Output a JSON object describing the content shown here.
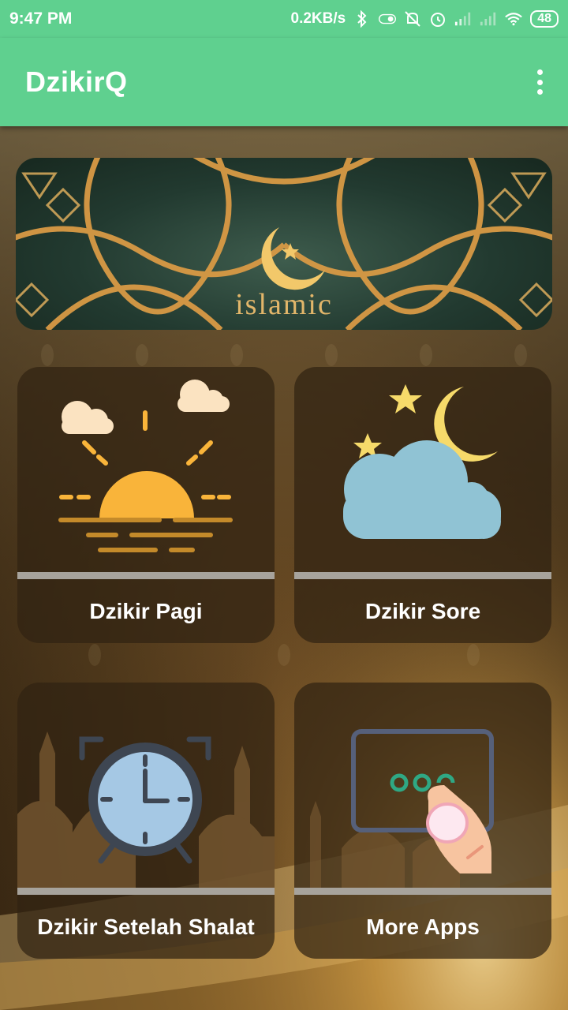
{
  "status_bar": {
    "time": "9:47 PM",
    "network_speed": "0.2KB/s",
    "battery": "48",
    "icons": [
      "bluetooth-icon",
      "toggle-icon",
      "mute-icon",
      "alarm-icon",
      "signal-icon",
      "signal-icon",
      "wifi-icon",
      "battery-icon"
    ]
  },
  "app_bar": {
    "title": "DzikirQ",
    "menu_icon": "more-vert-icon"
  },
  "banner": {
    "text": "islamic"
  },
  "cards": [
    {
      "label": "Dzikir Pagi",
      "icon": "sunrise-icon"
    },
    {
      "label": "Dzikir Sore",
      "icon": "moon-cloud-icon"
    },
    {
      "label": "Dzikir Setelah Shalat",
      "icon": "alarm-clock-icon"
    },
    {
      "label": "More Apps",
      "icon": "touch-screen-icon"
    }
  ],
  "colors": {
    "app_bar": "#5fd08f",
    "card_bg": "#30221270",
    "sun": "#f9b43a",
    "cloud_day": "#fbe3c1",
    "cloud_night": "#90c3d4",
    "moon": "#f6da6a",
    "clock_face": "#a5c8e4",
    "clock_frame": "#3e4652"
  }
}
